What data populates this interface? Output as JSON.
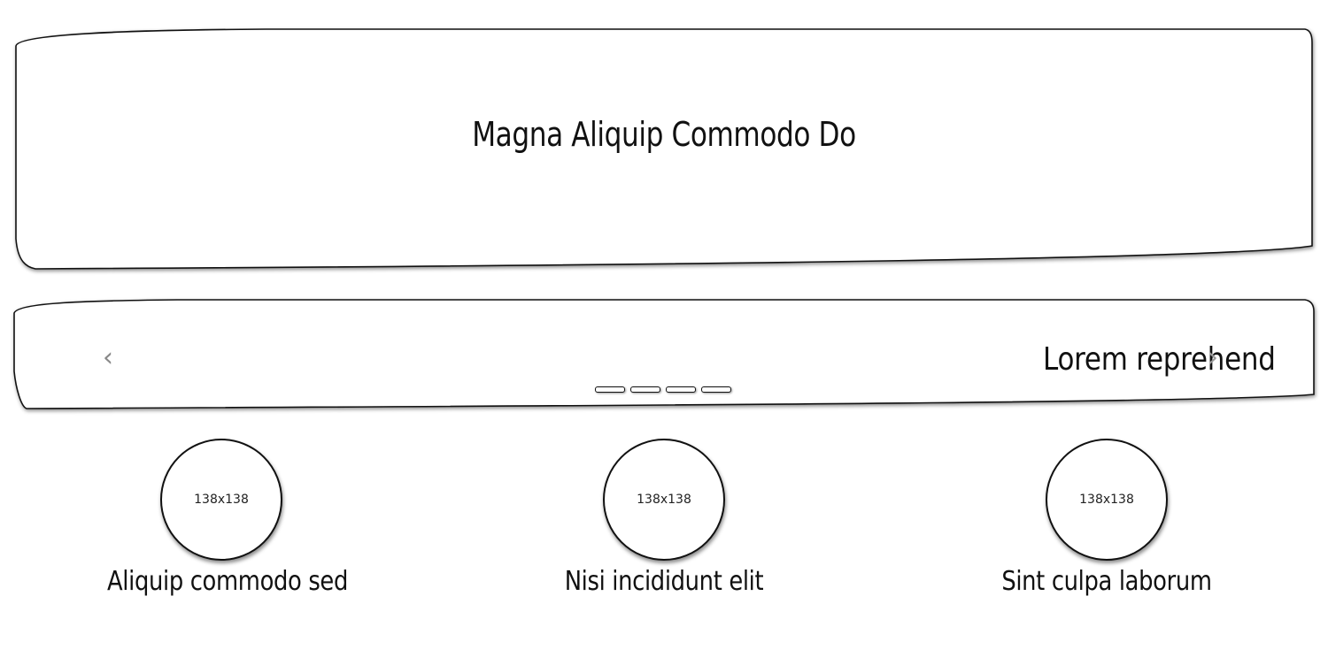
{
  "hero": {
    "title": "Magna Aliquip Commodo Do"
  },
  "carousel": {
    "slide_text": "Lorem reprehender",
    "prev_icon": "‹",
    "next_icon": "›",
    "indicator_count": 4
  },
  "features": [
    {
      "image_label": "138x138",
      "caption": "Aliquip commodo sed"
    },
    {
      "image_label": "138x138",
      "caption": "Nisi incididunt elit"
    },
    {
      "image_label": "138x138",
      "caption": "Sint culpa laborum"
    }
  ]
}
